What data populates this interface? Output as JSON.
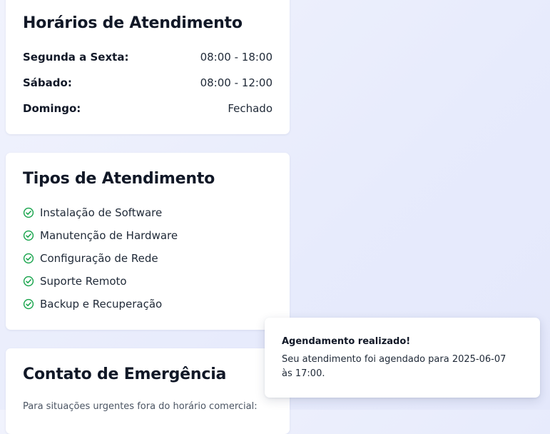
{
  "hours": {
    "title": "Horários de Atendimento",
    "rows": [
      {
        "day": "Segunda a Sexta:",
        "time": "08:00 - 18:00"
      },
      {
        "day": "Sábado:",
        "time": "08:00 - 12:00"
      },
      {
        "day": "Domingo:",
        "time": "Fechado"
      }
    ]
  },
  "types": {
    "title": "Tipos de Atendimento",
    "items": [
      "Instalação de Software",
      "Manutenção de Hardware",
      "Configuração de Rede",
      "Suporte Remoto",
      "Backup e Recuperação"
    ],
    "icon": "check-circle-icon",
    "icon_color": "#16a34a"
  },
  "emergency": {
    "title": "Contato de Emergência",
    "text": "Para situações urgentes fora do horário comercial:"
  },
  "toast": {
    "title": "Agendamento realizado!",
    "message": "Seu atendimento foi agendado para 2025-06-07 às 17:00."
  }
}
